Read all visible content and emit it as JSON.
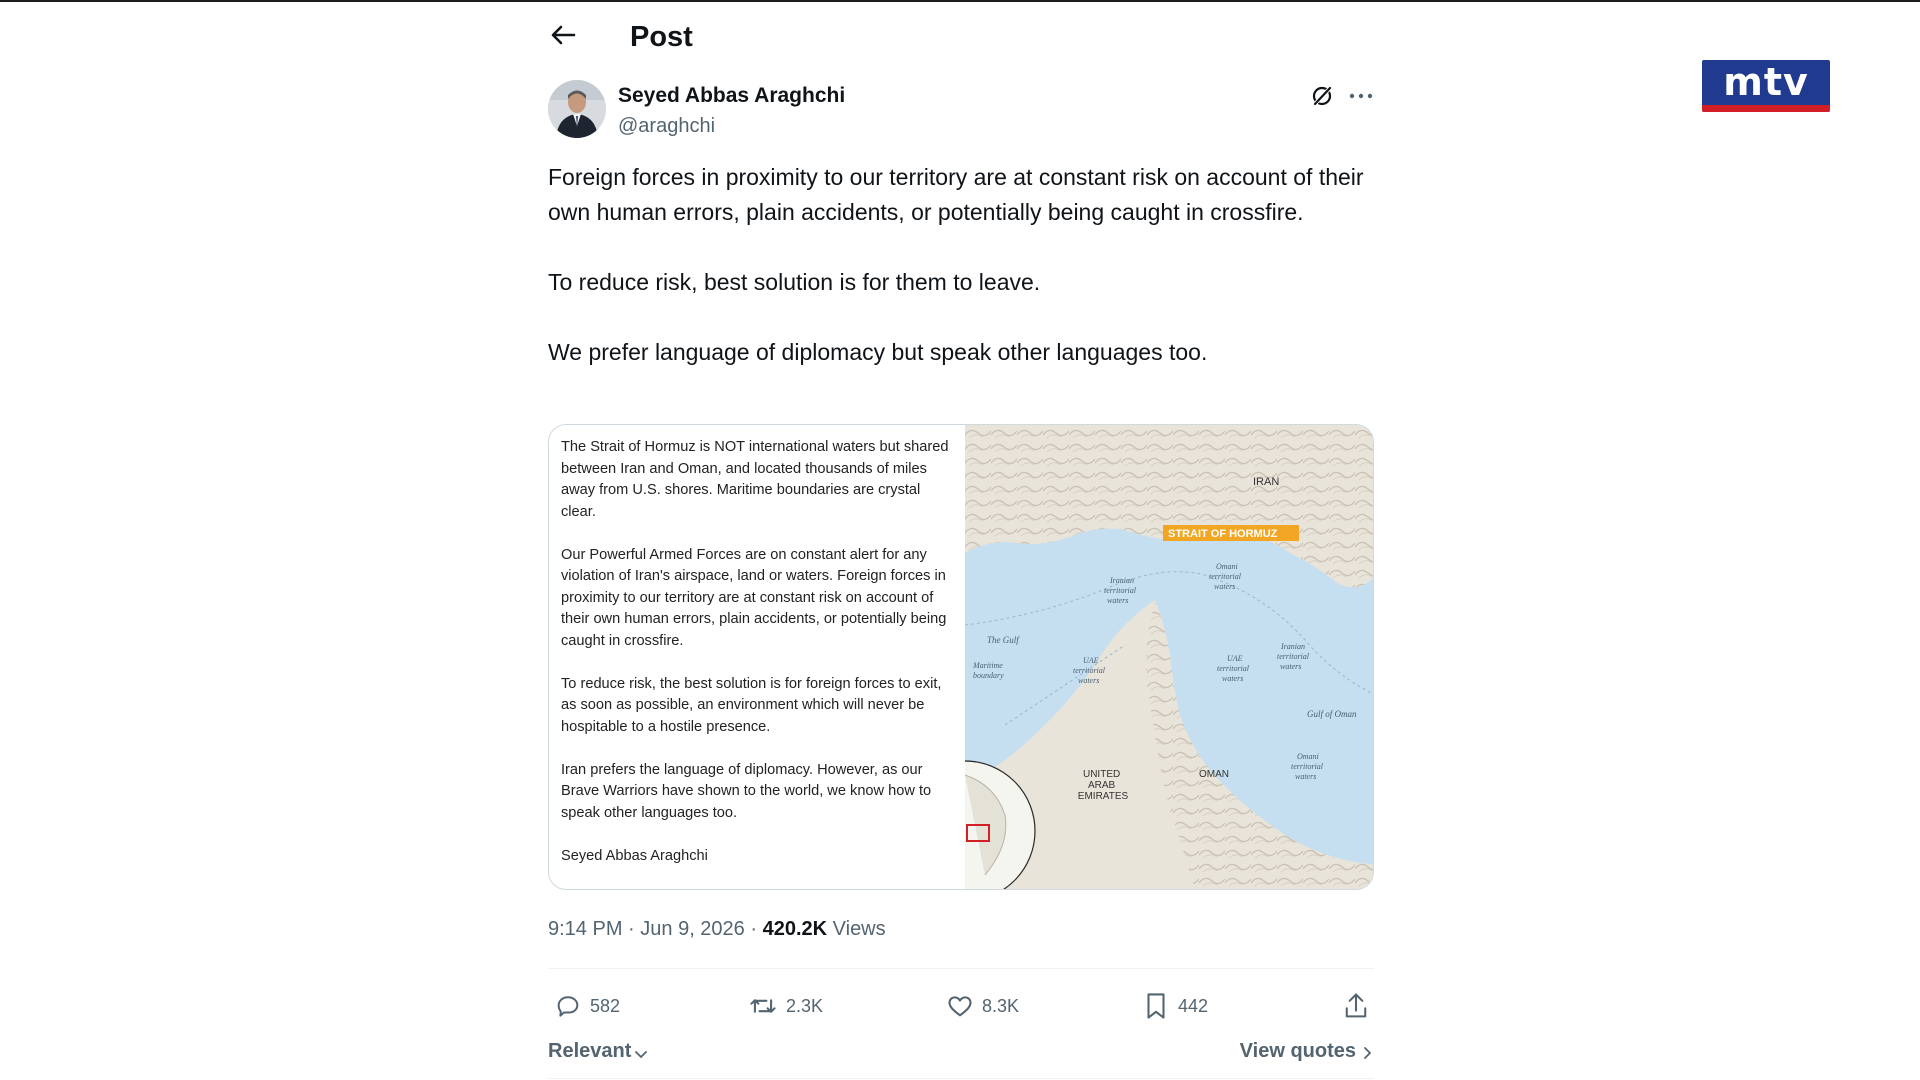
{
  "header": {
    "title": "Post"
  },
  "logo": {
    "text": "mtv",
    "brand_color": "#1f3a8f",
    "bar_color": "#d21f26"
  },
  "author": {
    "name": "Seyed Abbas Araghchi",
    "handle": "@araghchi"
  },
  "post": {
    "paragraphs": [
      "Foreign forces in proximity to our territory are at constant risk on account of their own human errors, plain accidents, or potentially being caught in crossfire.",
      "To reduce risk, best solution is for them to leave.",
      "We prefer language of diplomacy but speak other languages too."
    ]
  },
  "media": {
    "statement": [
      "The Strait of Hormuz is NOT international waters but shared between Iran and Oman, and located thousands of miles away from U.S. shores. Maritime boundaries are crystal clear.",
      "Our Powerful Armed Forces are on constant alert for any violation of Iran's airspace, land or waters. Foreign forces in proximity to our territory are at constant risk on account of their own human errors, plain accidents, or potentially being caught in crossfire.",
      "To reduce risk, the best solution is for foreign forces to exit, as soon as possible, an environment which will never be hospitable to a hostile presence.",
      "Iran prefers the language of diplomacy. However, as our Brave Warriors have shown to the world, we know how to speak other languages too.",
      "Seyed Abbas Araghchi"
    ],
    "map_labels": {
      "iran": "IRAN",
      "strait": "STRAIT OF HORMUZ",
      "iranian_waters_1": [
        "Iranian",
        "territorial",
        "waters"
      ],
      "omani_waters_1": [
        "Omani",
        "territorial",
        "waters"
      ],
      "the_gulf": "The Gulf",
      "maritime_boundary": [
        "Maritime",
        "boundary"
      ],
      "uae_waters_1": [
        "UAE",
        "territorial",
        "waters"
      ],
      "uae_waters_2": [
        "UAE",
        "territorial",
        "waters"
      ],
      "iranian_waters_2": [
        "Iranian",
        "territorial",
        "waters"
      ],
      "gulf_of_oman": "Gulf of Oman",
      "uae": [
        "UNITED",
        "ARAB",
        "EMIRATES"
      ],
      "oman": "OMAN",
      "omani_waters_2": [
        "Omani",
        "territorial",
        "waters"
      ]
    },
    "map_colors": {
      "water": "#c6dff0",
      "land": "#e9e4da",
      "accent": "#f3a623"
    }
  },
  "meta": {
    "time": "9:14 PM",
    "date": "Jun 9, 2026",
    "sep": " · ",
    "views_count": "420.2K",
    "views_label": "Views"
  },
  "actions": {
    "replies": "582",
    "reposts": "2.3K",
    "likes": "8.3K",
    "bookmarks": "442"
  },
  "footer": {
    "sort_label": "Relevant",
    "quotes_label": "View quotes"
  },
  "icons": [
    "back-arrow-icon",
    "grok-icon",
    "more-icon",
    "reply-icon",
    "repost-icon",
    "like-icon",
    "bookmark-icon",
    "share-icon",
    "chevron-down-icon",
    "chevron-right-icon"
  ]
}
